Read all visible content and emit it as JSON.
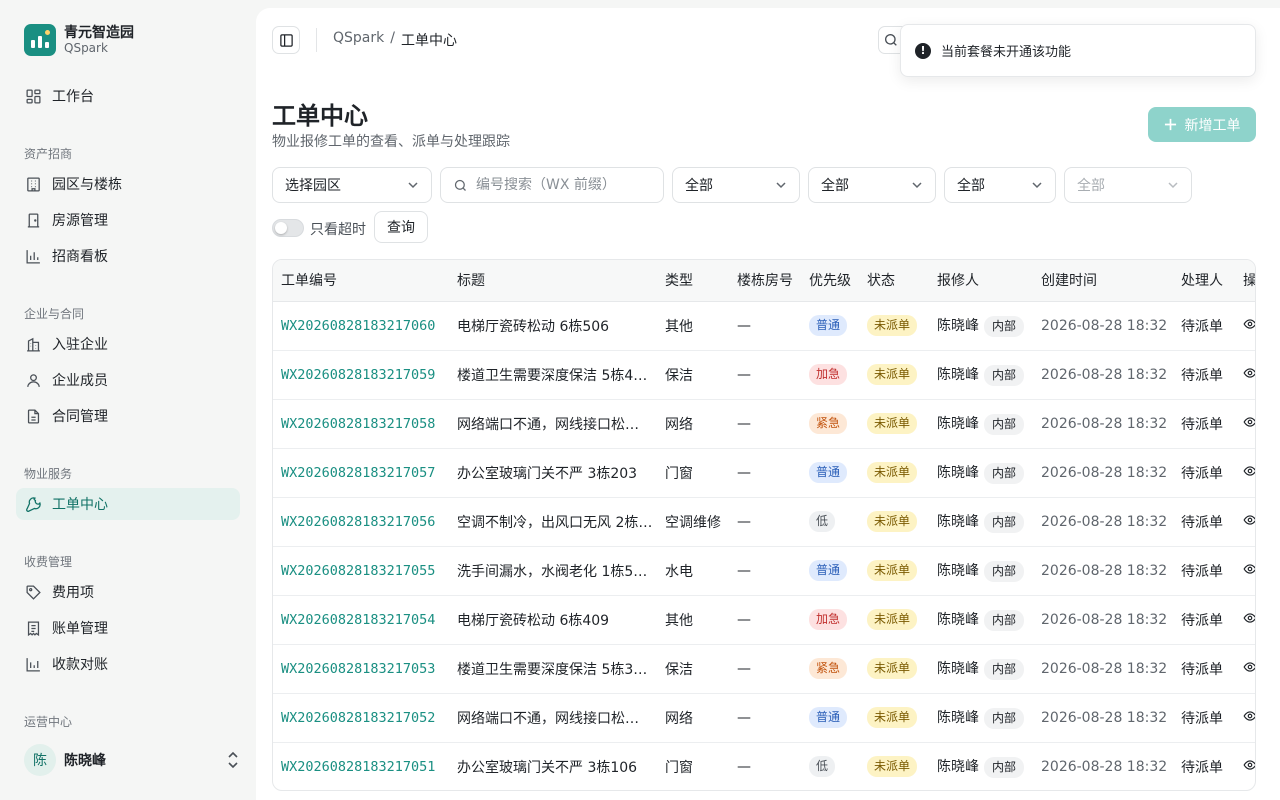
{
  "brand": {
    "name": "青元智造园",
    "sub": "QSpark"
  },
  "nav": {
    "workbench": "工作台",
    "sections": {
      "assets": "资产招商",
      "enterprise": "企业与合同",
      "property": "物业服务",
      "billing": "收费管理",
      "ops": "运营中心"
    },
    "items": {
      "park": "园区与楼栋",
      "housing": "房源管理",
      "investment_board": "招商看板",
      "companies": "入驻企业",
      "members": "企业成员",
      "contracts": "合同管理",
      "tickets": "工单中心",
      "fees": "费用项",
      "bills": "账单管理",
      "reconciliation": "收款对账"
    }
  },
  "user": {
    "avatar": "陈",
    "name": "陈晓峰"
  },
  "breadcrumb": {
    "root": "QSpark",
    "separator": "/",
    "current": "工单中心"
  },
  "page": {
    "title": "工单中心",
    "description": "物业报修工单的查看、派单与处理跟踪",
    "add_button": "新增工单"
  },
  "filters": {
    "park": "选择园区",
    "search_placeholder": "编号搜索（WX 前缀）",
    "type": "全部",
    "priority": "全部",
    "status": "全部",
    "disabled": "全部",
    "overdue_label": "只看超时",
    "query_button": "查询"
  },
  "toast": {
    "icon": "!",
    "message": "当前套餐未开通该功能"
  },
  "table": {
    "columns": [
      "工单编号",
      "标题",
      "类型",
      "楼栋房号",
      "优先级",
      "状态",
      "报修人",
      "创建时间",
      "处理人",
      "操"
    ],
    "rows": [
      {
        "code": "WX20260828183217060",
        "title": "电梯厅瓷砖松动 6栋506",
        "type": "其他",
        "room": "—",
        "priority": "普通",
        "status": "未派单",
        "reporter": "陈晓峰",
        "tag": "内部",
        "created": "2026-08-28 18:32",
        "handler": "待派单"
      },
      {
        "code": "WX20260828183217059",
        "title": "楼道卫生需要深度保洁 5栋4…",
        "type": "保洁",
        "room": "—",
        "priority": "加急",
        "status": "未派单",
        "reporter": "陈晓峰",
        "tag": "内部",
        "created": "2026-08-28 18:32",
        "handler": "待派单"
      },
      {
        "code": "WX20260828183217058",
        "title": "网络端口不通，网线接口松…",
        "type": "网络",
        "room": "—",
        "priority": "紧急",
        "status": "未派单",
        "reporter": "陈晓峰",
        "tag": "内部",
        "created": "2026-08-28 18:32",
        "handler": "待派单"
      },
      {
        "code": "WX20260828183217057",
        "title": "办公室玻璃门关不严 3栋203",
        "type": "门窗",
        "room": "—",
        "priority": "普通",
        "status": "未派单",
        "reporter": "陈晓峰",
        "tag": "内部",
        "created": "2026-08-28 18:32",
        "handler": "待派单"
      },
      {
        "code": "WX20260828183217056",
        "title": "空调不制冷，出风口无风 2栋…",
        "type": "空调维修",
        "room": "—",
        "priority": "低",
        "status": "未派单",
        "reporter": "陈晓峰",
        "tag": "内部",
        "created": "2026-08-28 18:32",
        "handler": "待派单"
      },
      {
        "code": "WX20260828183217055",
        "title": "洗手间漏水，水阀老化 1栋5…",
        "type": "水电",
        "room": "—",
        "priority": "普通",
        "status": "未派单",
        "reporter": "陈晓峰",
        "tag": "内部",
        "created": "2026-08-28 18:32",
        "handler": "待派单"
      },
      {
        "code": "WX20260828183217054",
        "title": "电梯厅瓷砖松动 6栋409",
        "type": "其他",
        "room": "—",
        "priority": "加急",
        "status": "未派单",
        "reporter": "陈晓峰",
        "tag": "内部",
        "created": "2026-08-28 18:32",
        "handler": "待派单"
      },
      {
        "code": "WX20260828183217053",
        "title": "楼道卫生需要深度保洁 5栋3…",
        "type": "保洁",
        "room": "—",
        "priority": "紧急",
        "status": "未派单",
        "reporter": "陈晓峰",
        "tag": "内部",
        "created": "2026-08-28 18:32",
        "handler": "待派单"
      },
      {
        "code": "WX20260828183217052",
        "title": "网络端口不通，网线接口松…",
        "type": "网络",
        "room": "—",
        "priority": "普通",
        "status": "未派单",
        "reporter": "陈晓峰",
        "tag": "内部",
        "created": "2026-08-28 18:32",
        "handler": "待派单"
      },
      {
        "code": "WX20260828183217051",
        "title": "办公室玻璃门关不严 3栋106",
        "type": "门窗",
        "room": "—",
        "priority": "低",
        "status": "未派单",
        "reporter": "陈晓峰",
        "tag": "内部",
        "created": "2026-08-28 18:32",
        "handler": "待派单"
      }
    ]
  },
  "colors": {
    "accent": "#1a8f82",
    "priority": {
      "普通": {
        "bg": "#dfeafd",
        "fg": "#2b5fb8"
      },
      "加急": {
        "bg": "#fde1e1",
        "fg": "#c1302e"
      },
      "紧急": {
        "bg": "#fde8d6",
        "fg": "#c2540f"
      },
      "低": {
        "bg": "#eef0f2",
        "fg": "#4a5057"
      }
    },
    "status": {
      "bg": "#fdf3c4",
      "fg": "#7a5a00"
    }
  }
}
